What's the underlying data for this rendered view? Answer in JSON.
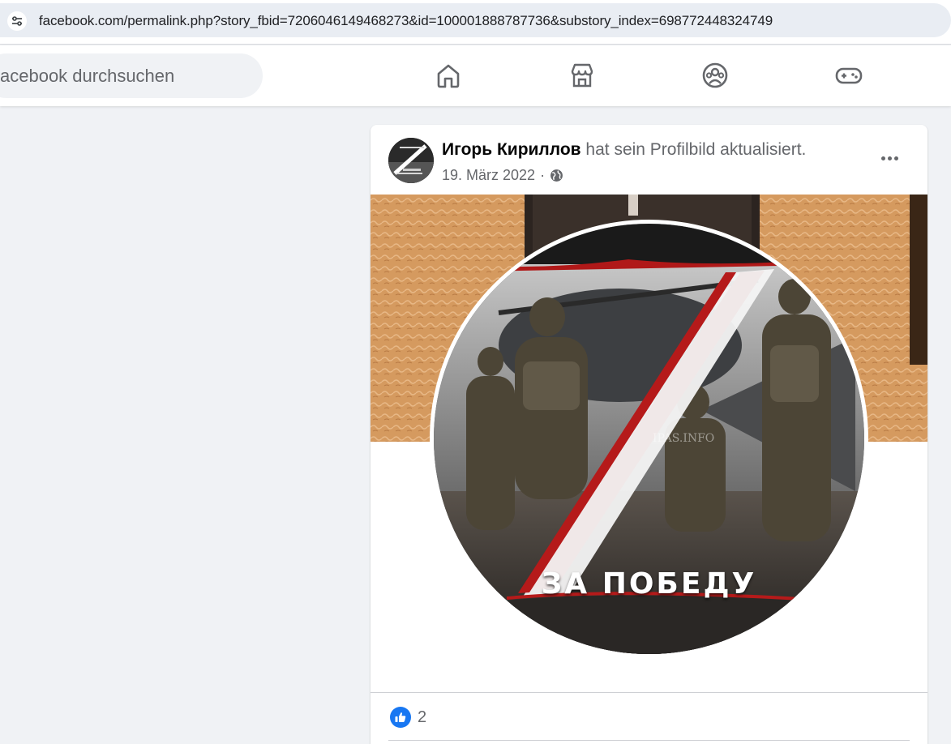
{
  "browser": {
    "url": "facebook.com/permalink.php?story_fbid=7206046149468273&id=100001888787736&substory_index=698772448324749",
    "icon": "site-settings-icon"
  },
  "nav": {
    "search_placeholder": "acebook durchsuchen",
    "icons": [
      "home-icon",
      "marketplace-icon",
      "groups-icon",
      "gaming-icon"
    ]
  },
  "post": {
    "author": "Игорь Кириллов",
    "action": " hat sein Profilbild aktualisiert.",
    "date": "19. März 2022",
    "separator": "·",
    "privacy_icon": "globe-icon",
    "image_caption": "ЗА ПОБЕДУ",
    "image_watermark": "IPAS.INFO",
    "reaction_icon": "like-icon",
    "reaction_count": "2"
  },
  "colors": {
    "fb_blue": "#1877f2",
    "secondary_text": "#65676b",
    "background": "#f0f2f5"
  }
}
